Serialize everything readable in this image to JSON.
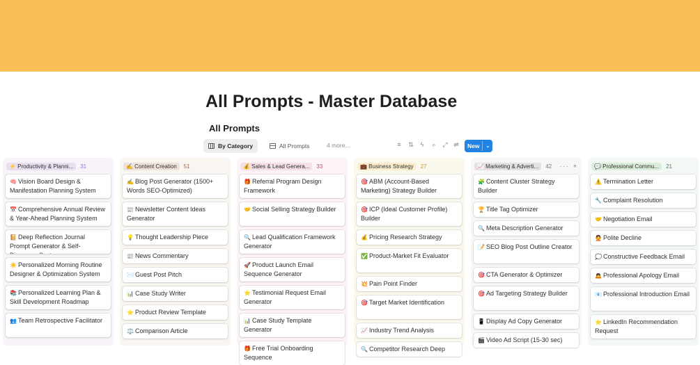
{
  "page": {
    "title": "All Prompts - Master Database"
  },
  "view": {
    "title": "All Prompts",
    "tabs": [
      {
        "label": "By Category",
        "icon": "board-icon"
      },
      {
        "label": "All Prompts",
        "icon": "table-icon"
      }
    ],
    "more_label": "4 more...",
    "new_label": "New",
    "toolbar_icons": [
      "filter-icon",
      "sort-icon",
      "automation-icon",
      "search-icon",
      "expand-icon",
      "settings-icon"
    ]
  },
  "colors": {
    "banner": "#f9bf57",
    "accent": "#2383e2"
  },
  "columns": [
    {
      "label": "⚡ Productivity & Planni...",
      "count": "31",
      "tint": "#f7f3f8",
      "tag_bg": "#e8deee",
      "count_color": "#9a6dd7",
      "cards": [
        {
          "icon": "🧠",
          "text": "Vision Board Design & Manifestation Planning System"
        },
        {
          "icon": "📅",
          "text": "Comprehensive Annual Review & Year-Ahead Planning System"
        },
        {
          "icon": "📔",
          "text": "Deep Reflection Journal Prompt Generator & Self-Discovery System"
        },
        {
          "icon": "☀️",
          "text": "Personalized Morning Routine Designer & Optimization System"
        },
        {
          "icon": "📚",
          "text": "Personalized Learning Plan & Skill Development Roadmap"
        },
        {
          "icon": "👥",
          "text": "Team Retrospective Facilitator"
        }
      ]
    },
    {
      "label": "✍️ Content Creation",
      "count": "51",
      "tint": "#f9f5f1",
      "tag_bg": "#eee0da",
      "count_color": "#9f6b53",
      "cards": [
        {
          "icon": "✍️",
          "text": "Blog Post Generator (1500+ Words SEO-Optimized)"
        },
        {
          "icon": "📰",
          "text": "Newsletter Content Ideas Generator"
        },
        {
          "icon": "💡",
          "text": "Thought Leadership Piece"
        },
        {
          "icon": "📰",
          "text": "News Commentary"
        },
        {
          "icon": "✉️",
          "text": "Guest Post Pitch"
        },
        {
          "icon": "📊",
          "text": "Case Study Writer"
        },
        {
          "icon": "⭐",
          "text": "Product Review Template"
        },
        {
          "icon": "⚖️",
          "text": "Comparison Article"
        }
      ]
    },
    {
      "label": "💰 Sales & Lead Genera...",
      "count": "33",
      "tint": "#fbf3f6",
      "tag_bg": "#f5e0e9",
      "count_color": "#c14c8a",
      "cards": [
        {
          "icon": "🎁",
          "text": "Referral Program Design Framework"
        },
        {
          "icon": "🤝",
          "text": "Social Selling Strategy Builder"
        },
        {
          "icon": "🔍",
          "text": "Lead Qualification Framework Generator"
        },
        {
          "icon": "🚀",
          "text": "Product Launch Email Sequence Generator"
        },
        {
          "icon": "⭐",
          "text": "Testimonial Request Email Generator"
        },
        {
          "icon": "📊",
          "text": "Case Study Template Generator"
        },
        {
          "icon": "🎁",
          "text": "Free Trial Onboarding Sequence"
        }
      ]
    },
    {
      "label": "💼 Business Strategy",
      "count": "27",
      "tint": "#fbf8ee",
      "tag_bg": "#fbeecc",
      "count_color": "#cb912f",
      "cards": [
        {
          "icon": "🎯",
          "text": "ABM (Account-Based Marketing) Strategy Builder"
        },
        {
          "icon": "🎯",
          "text": "ICP (Ideal Customer Profile) Builder"
        },
        {
          "icon": "💰",
          "text": "Pricing Research Strategy"
        },
        {
          "icon": "✅",
          "text": "Product-Market Fit Evaluator"
        },
        {
          "icon": "💥",
          "text": "Pain Point Finder"
        },
        {
          "icon": "🎯",
          "text": "Target Market Identification"
        },
        {
          "icon": "📈",
          "text": "Industry Trend Analysis"
        },
        {
          "icon": "🔍",
          "text": "Competitor Research Deep"
        }
      ]
    },
    {
      "label": "📈 Marketing & Adverti...",
      "count": "42",
      "tint": "#f7f7f5",
      "tag_bg": "#e3e2e0",
      "count_color": "#787774",
      "actions": "··· +",
      "cards": [
        {
          "icon": "🧩",
          "text": "Content Cluster Strategy Builder"
        },
        {
          "icon": "🏆",
          "text": "Title Tag Optimizer"
        },
        {
          "icon": "🔍",
          "text": "Meta Description Generator"
        },
        {
          "icon": "📝",
          "text": "SEO Blog Post Outline Creator"
        },
        {
          "icon": "🎯",
          "text": "CTA Generator & Optimizer"
        },
        {
          "icon": "🎯",
          "text": "Ad Targeting Strategy Builder"
        },
        {
          "icon": "📱",
          "text": "Display Ad Copy Generator"
        },
        {
          "icon": "🎬",
          "text": "Video Ad Script (15-30 sec)"
        }
      ]
    },
    {
      "label": "💬 Professional Commu...",
      "count": "21",
      "tint": "#f4f8f5",
      "tag_bg": "#dbeddb",
      "count_color": "#448361",
      "cards": [
        {
          "icon": "⚠️",
          "text": "Termination Letter"
        },
        {
          "icon": "🔧",
          "text": "Complaint Resolution"
        },
        {
          "icon": "🤝",
          "text": "Negotiation Email"
        },
        {
          "icon": "🙅",
          "text": "Polite Decline"
        },
        {
          "icon": "💭",
          "text": "Constructive Feedback Email"
        },
        {
          "icon": "🙇",
          "text": "Professional Apology Email"
        },
        {
          "icon": "📧",
          "text": "Professional Introduction Email"
        },
        {
          "icon": "⭐",
          "text": "LinkedIn Recommendation Request"
        }
      ]
    }
  ]
}
